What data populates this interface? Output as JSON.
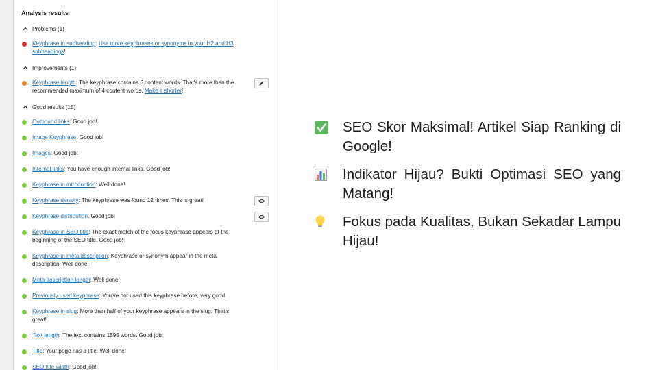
{
  "panel": {
    "title": "Analysis results",
    "sections": {
      "problems": {
        "label": "Problems (1)",
        "items": [
          {
            "link": "Keyphrase in subheading",
            "sep": ": ",
            "link2": "Use more keyphrases or synonyms in your H2 and H3 subheadings",
            "after": "!"
          }
        ]
      },
      "improvements": {
        "label": "Improvements (1)",
        "items": [
          {
            "link": "Keyphrase length",
            "text": ": The keyphrase contains 6 content words. That's more than the recommended maximum of 4 content words. ",
            "link2": "Make it shorter",
            "after": "!"
          }
        ]
      },
      "good": {
        "label": "Good results (15)",
        "items": [
          {
            "link": "Outbound links",
            "text": ": Good job!"
          },
          {
            "link": "Image Keyphrase",
            "text": ": Good job!"
          },
          {
            "link": "Images",
            "text": ": Good job!"
          },
          {
            "link": "Internal links",
            "text": ": You have enough internal links. Good job!"
          },
          {
            "link": "Keyphrase in introduction",
            "text": ": Well done!"
          },
          {
            "link": "Keyphrase density",
            "text": ": The keyphrase was found 12 times. This is great!"
          },
          {
            "link": "Keyphrase distribution",
            "text": ": Good job!"
          },
          {
            "link": "Keyphrase in SEO title",
            "text": ": The exact match of the focus keyphrase appears at the beginning of the SEO title. Good job!"
          },
          {
            "link": "Keyphrase in meta description",
            "text": ": Keyphrase or synonym appear in the meta description. Well done!"
          },
          {
            "link": "Meta description length",
            "text": ": Well done!"
          },
          {
            "link": "Previously used keyphrase",
            "text": ": You've not used this keyphrase before, very good."
          },
          {
            "link": "Keyphrase in slug",
            "text": ": More than half of your keyphrase appears in the slug. That's great!"
          },
          {
            "link": "Text length",
            "text": ": The text contains 1595 words. Good job!"
          },
          {
            "link": "Title",
            "text": ": Your page has a title. Well done!"
          },
          {
            "link": "SEO title width",
            "text": ": Good job!"
          }
        ]
      }
    }
  },
  "features": [
    {
      "icon": "check-mark-icon",
      "text": "SEO Skor Maksimal! Artikel Siap Ranking di Google!"
    },
    {
      "icon": "bar-chart-icon",
      "text": "Indikator Hijau? Bukti Optimasi SEO yang Matang!"
    },
    {
      "icon": "light-bulb-icon",
      "text": "Fokus pada Kualitas, Bukan Sekadar Lampu Hijau!"
    }
  ],
  "colors": {
    "problem": "#dc3232",
    "improvement": "#ee7c1b",
    "good": "#7ad03a",
    "link": "#2271b1",
    "check": "#5cb85c"
  }
}
